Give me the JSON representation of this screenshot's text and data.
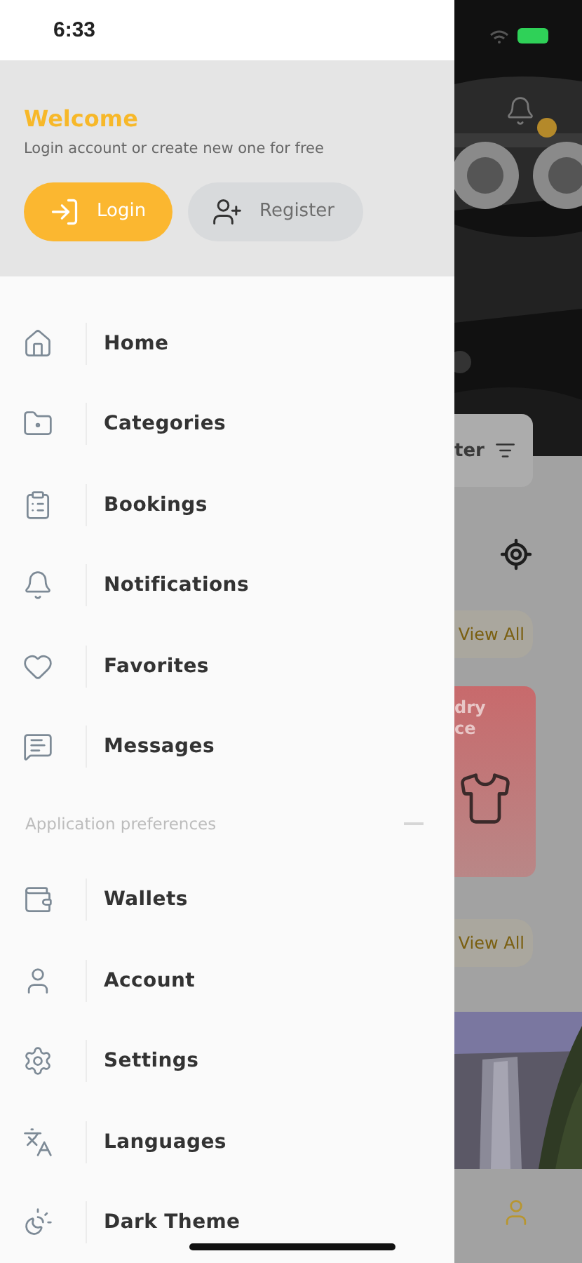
{
  "status_bar": {
    "time": "6:33"
  },
  "header": {
    "title": "Welcome",
    "subtitle": "Login account or create new one for free",
    "buttons": [
      {
        "label": "Login",
        "kind": "primary"
      },
      {
        "label": "Register",
        "kind": "secondary"
      }
    ]
  },
  "menu": [
    {
      "label": "Home"
    },
    {
      "label": "Categories"
    },
    {
      "label": "Bookings"
    },
    {
      "label": "Notifications"
    },
    {
      "label": "Favorites"
    },
    {
      "label": "Messages"
    }
  ],
  "section": {
    "title": "Application preferences"
  },
  "preferences": [
    {
      "label": "Wallets"
    },
    {
      "label": "Account"
    },
    {
      "label": "Settings"
    },
    {
      "label": "Languages"
    },
    {
      "label": "Dark Theme"
    }
  ],
  "background": {
    "filter_label": "ter",
    "view_all": [
      "View All",
      "View All"
    ],
    "card_lines": [
      "dry",
      "ce"
    ]
  }
}
